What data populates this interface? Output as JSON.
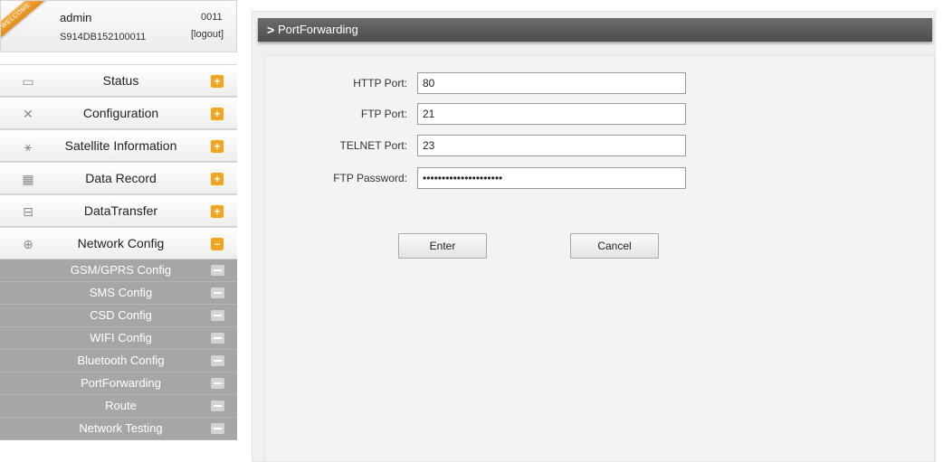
{
  "user": {
    "ribbon": "WELCOME",
    "name": "admin",
    "serial": "S914DB152100011",
    "code": "0011",
    "logout": "[logout]"
  },
  "menu": [
    {
      "label": "Status",
      "icon": "monitor-icon",
      "glyph": "▭",
      "toggle": "+"
    },
    {
      "label": "Configuration",
      "icon": "tools-icon",
      "glyph": "✕",
      "toggle": "+"
    },
    {
      "label": "Satellite Information",
      "icon": "satellite-icon",
      "glyph": "⚹",
      "toggle": "+"
    },
    {
      "label": "Data Record",
      "icon": "calendar-icon",
      "glyph": "▦",
      "toggle": "+"
    },
    {
      "label": "DataTransfer",
      "icon": "network-icon",
      "glyph": "⊟",
      "toggle": "+"
    },
    {
      "label": "Network Config",
      "icon": "globe-icon",
      "glyph": "⊕",
      "toggle": "−"
    }
  ],
  "submenu": [
    {
      "label": "GSM/GPRS Config"
    },
    {
      "label": "SMS Config"
    },
    {
      "label": "CSD Config"
    },
    {
      "label": "WIFI Config"
    },
    {
      "label": "Bluetooth Config"
    },
    {
      "label": "PortForwarding"
    },
    {
      "label": "Route"
    },
    {
      "label": "Network Testing"
    }
  ],
  "page": {
    "chevron": ">",
    "title": "PortForwarding"
  },
  "form": {
    "http_label": "HTTP Port:",
    "http_value": "80",
    "ftp_label": "FTP Port:",
    "ftp_value": "21",
    "telnet_label": "TELNET Port:",
    "telnet_value": "23",
    "password_label": "FTP Password:",
    "password_value": "*********************"
  },
  "buttons": {
    "enter": "Enter",
    "cancel": "Cancel"
  },
  "colors": {
    "toggle_accent": "#f2a51d",
    "title_bar": "#5a5a5a",
    "submenu_bg": "#a6a6a6"
  }
}
